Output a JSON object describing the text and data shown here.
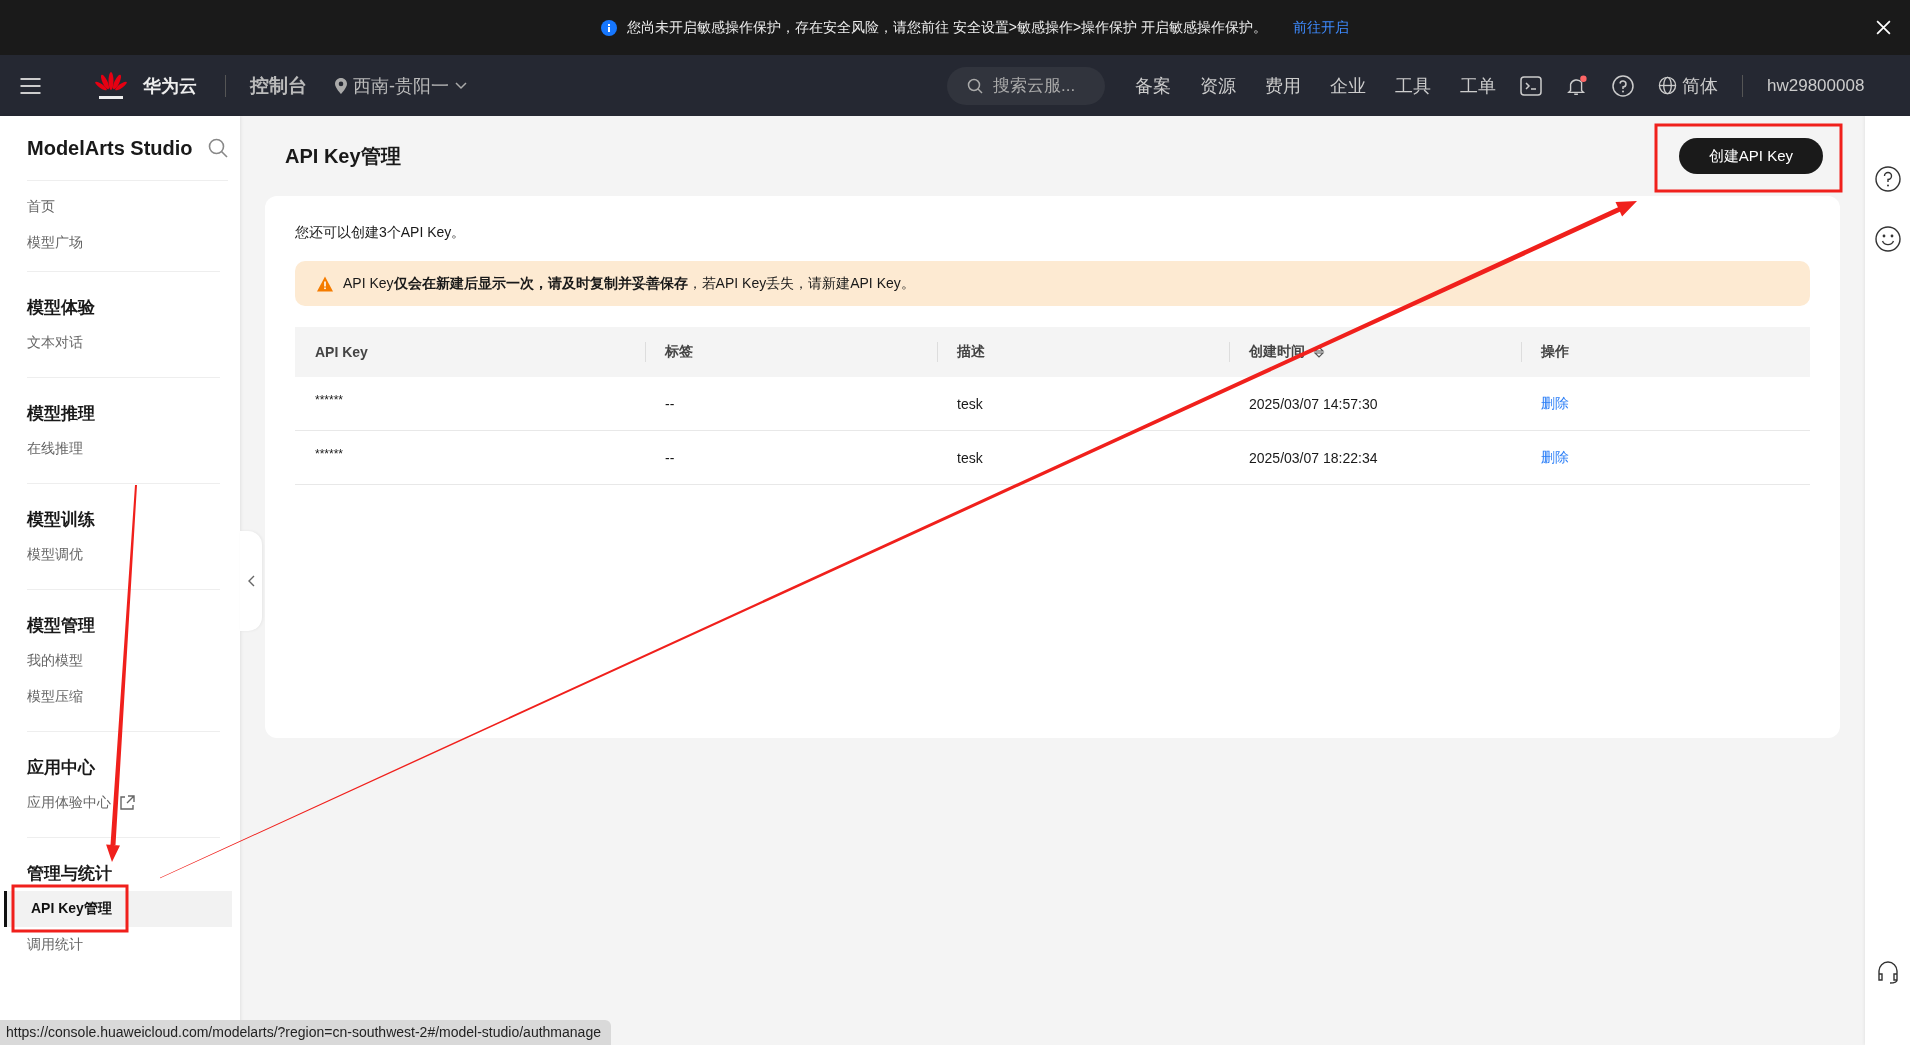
{
  "banner": {
    "text": "您尚未开启敏感操作保护，存在安全风险，请您前往 安全设置>敏感操作>操作保护 开启敏感操作保护。",
    "link": "前往开启"
  },
  "nav": {
    "brand": "华为云",
    "console": "控制台",
    "region": "西南-贵阳一",
    "search_placeholder": "搜索云服...",
    "menu": [
      "备案",
      "资源",
      "费用",
      "企业",
      "工具",
      "工单"
    ],
    "has_unread": true,
    "language": "简体",
    "user": "hw29800008"
  },
  "sidebar": {
    "title": "ModelArts Studio",
    "sections": [
      {
        "items": [
          {
            "label": "首页",
            "selected": false,
            "external": false
          },
          {
            "label": "模型广场",
            "selected": false,
            "external": false
          }
        ]
      },
      {
        "heading": "模型体验",
        "items": [
          {
            "label": "文本对话",
            "selected": false,
            "external": false
          }
        ]
      },
      {
        "heading": "模型推理",
        "items": [
          {
            "label": "在线推理",
            "selected": false,
            "external": false
          }
        ]
      },
      {
        "heading": "模型训练",
        "items": [
          {
            "label": "模型调优",
            "selected": false,
            "external": false
          }
        ]
      },
      {
        "heading": "模型管理",
        "items": [
          {
            "label": "我的模型",
            "selected": false,
            "external": false
          },
          {
            "label": "模型压缩",
            "selected": false,
            "external": false
          }
        ]
      },
      {
        "heading": "应用中心",
        "items": [
          {
            "label": "应用体验中心",
            "selected": false,
            "external": true
          }
        ]
      },
      {
        "heading": "管理与统计",
        "items": [
          {
            "label": "API Key管理",
            "selected": true,
            "external": false
          },
          {
            "label": "调用统计",
            "selected": false,
            "external": false
          }
        ]
      }
    ]
  },
  "page": {
    "title": "API Key管理",
    "create_button": "创建API Key"
  },
  "card": {
    "quota": "您还可以创建3个API Key。",
    "warning": "API Key**仅会在新建后显示一次，请及时复制并妥善保存**，若API Key丢失，请新建API Key。"
  },
  "table": {
    "columns": [
      {
        "label": "API Key",
        "sortable": false
      },
      {
        "label": "标签",
        "sortable": false
      },
      {
        "label": "描述",
        "sortable": false
      },
      {
        "label": "创建时间",
        "sortable": true
      },
      {
        "label": "操作",
        "sortable": false
      }
    ],
    "rows": [
      {
        "cells": [
          "******",
          "--",
          "tesk",
          "2025/03/07 14:57:30"
        ],
        "action": "删除"
      },
      {
        "cells": [
          "******",
          "--",
          "tesk",
          "2025/03/07 18:22:34"
        ],
        "action": "删除"
      }
    ]
  },
  "status_url": "https://console.huaweicloud.com/modelarts/?region=cn-southwest-2#/model-studio/authmanage"
}
